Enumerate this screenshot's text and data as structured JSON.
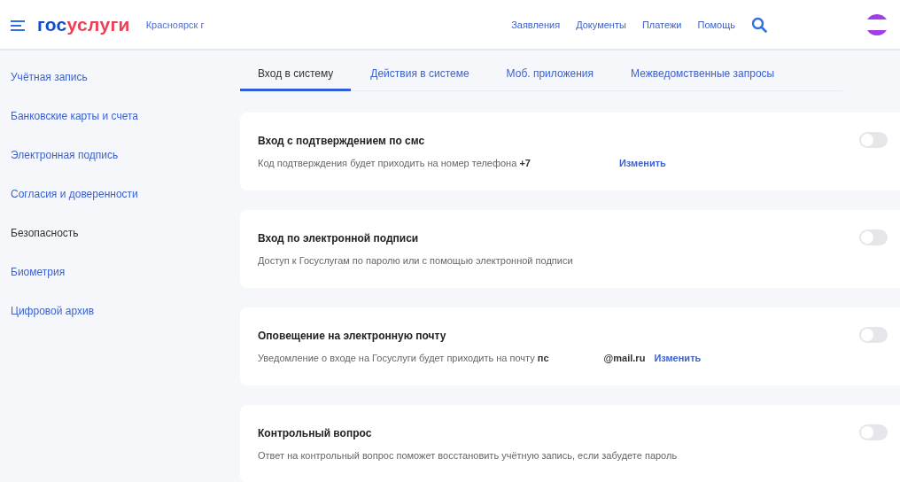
{
  "header": {
    "logo": {
      "part_1": "гос",
      "part_2": "услуги"
    },
    "city": "Красноярск г",
    "nav": [
      "Заявления",
      "Документы",
      "Платежи",
      "Помощь"
    ]
  },
  "sidebar": {
    "items": [
      {
        "label": "Учётная запись",
        "selected": false
      },
      {
        "label": "Банковские карты и счета",
        "selected": false
      },
      {
        "label": "Электронная подпись",
        "selected": false
      },
      {
        "label": "Согласия и доверенности",
        "selected": false
      },
      {
        "label": "Безопасность",
        "selected": true
      },
      {
        "label": "Биометрия",
        "selected": false
      },
      {
        "label": "Цифровой архив",
        "selected": false
      }
    ]
  },
  "tabs": [
    {
      "label": "Вход в систему",
      "selected": true
    },
    {
      "label": "Действия в системе",
      "selected": false
    },
    {
      "label": "Моб. приложения",
      "selected": false
    },
    {
      "label": "Межведомственные запросы",
      "selected": false
    }
  ],
  "cards": [
    {
      "title": "Вход с подтверждением по смс",
      "description": "Код подтверждения будет приходить на номер телефона **+7**",
      "link": "Изменить",
      "on": false
    },
    {
      "title": "Вход по электронной подписи",
      "description": "Доступ к Госуслугам по паролю или с помощью электронной подписи",
      "on": false
    },
    {
      "title": "Оповещение на электронную почту",
      "description": "Уведомление о входе на Госуслуги будет приходить на почту **пс**",
      "detail": "@mail.ru",
      "link": "Изменить",
      "on": false
    },
    {
      "title": "Контрольный вопрос",
      "description": "Ответ на контрольный вопрос поможет восстановить учётную запись, если забудете пароль",
      "on": false
    }
  ]
}
